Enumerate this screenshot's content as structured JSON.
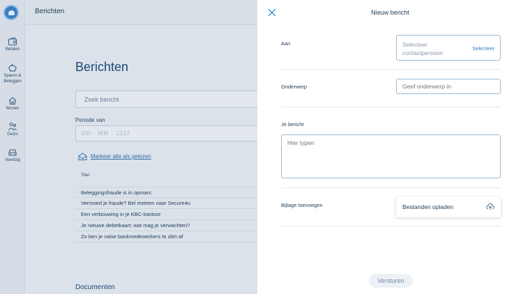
{
  "app": {
    "header_title": "Berichten"
  },
  "sidebar": {
    "items": [
      {
        "label": "Betalen",
        "icon": "wallet-icon"
      },
      {
        "label": "Sparen & Beleggen",
        "icon": "piggy-bank-icon"
      },
      {
        "label": "Wonen",
        "icon": "house-icon"
      },
      {
        "label": "Gezin",
        "icon": "family-icon"
      },
      {
        "label": "Voertuig",
        "icon": "car-icon"
      }
    ]
  },
  "main": {
    "title": "Berichten",
    "search_placeholder": "Zoek bericht",
    "period_label": "Periode van",
    "date_placeholder": "DD  -  MM  -  JJJJ",
    "mark_all_read": "Markeer alle als gelezen",
    "column_title": "Titel",
    "messages": [
      "Beleggingsfraude is in opmars",
      "Vermoed je fraude? Bel meteen naar Secure4u",
      "Een verbouwing in je KBC-kantoor",
      "Je nieuwe debetkaart: wat mag je verwachten?",
      "Zo ben je valse bankmedewerkers te slim af"
    ],
    "documents_title": "Documenten"
  },
  "panel": {
    "title": "Nieuw bericht",
    "to_label": "Aan",
    "to_placeholder": "Selecteer contactpersoon",
    "to_select": "Selecteer",
    "subject_label": "Onderwerp",
    "subject_placeholder": "Geef onderwerp in",
    "message_label": "Je bericht",
    "message_placeholder": "Hier typen",
    "attachment_label": "Bijlage toevoegen",
    "upload_label": "Bestanden opladen",
    "send_label": "Versturen"
  },
  "colors": {
    "accent": "#2f7ac0",
    "brand": "#3b7fc0",
    "overlay": "#dfe4ea"
  }
}
